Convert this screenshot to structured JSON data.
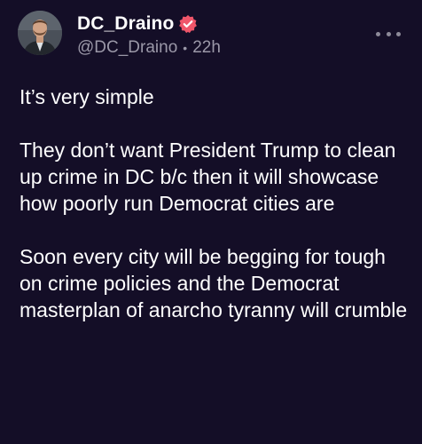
{
  "post": {
    "author": {
      "display_name": "DC_Draino",
      "handle": "@DC_Draino",
      "verified": true,
      "badge_color": "#f0566a"
    },
    "separator": "•",
    "timestamp": "22h",
    "more_icon": "more-horizontal-icon",
    "paragraphs": [
      "It’s very simple",
      "They don’t want President Trump to clean up crime in DC b/c then it will showcase how poorly run Democrat cities are",
      "Soon every city will be begging for tough on crime policies and the Democrat masterplan of anarcho tyranny will crumble"
    ]
  },
  "colors": {
    "background": "#140e27",
    "text": "#ffffff",
    "muted": "#9b98a8"
  }
}
